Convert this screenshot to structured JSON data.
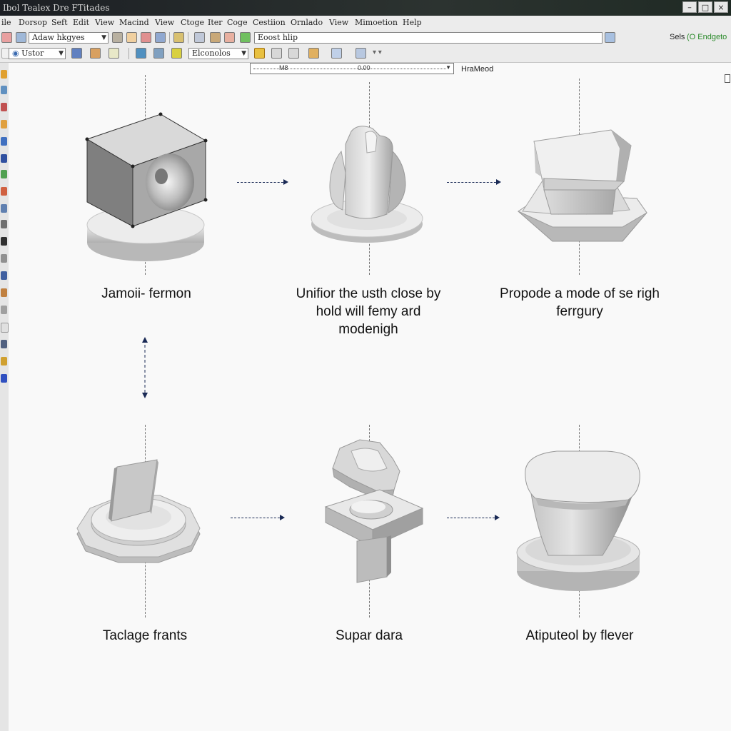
{
  "window": {
    "title": "Ibol Tealex Dre FTitades",
    "buttons": [
      "–",
      "□",
      "×"
    ]
  },
  "menubar": {
    "items": [
      "ile",
      "Dorsop",
      "Seft",
      "Edit",
      "View",
      "Macind",
      "View",
      "Ctoge",
      "Iter",
      "Coge",
      "Cestiion",
      "Ornlado",
      "View",
      "Mimoetion",
      "Help"
    ]
  },
  "toolbar1": {
    "layer_combo": "Adaw hkgyes",
    "help_field": "Eoost hlip",
    "right_label": "Sels",
    "right_status": "(O Endgeto"
  },
  "toolbar2": {
    "view_combo": "Ustor",
    "style_combo": "Elconolos"
  },
  "ruler": {
    "left_mark": "M8",
    "value": "0.00",
    "label": "HraMeod"
  },
  "steps": [
    {
      "caption": "Jamoii- fermon"
    },
    {
      "caption": "Unifior the usth close by hold will femy ard modenigh"
    },
    {
      "caption": "Propode a mode of se righ ferrgury"
    },
    {
      "caption": "Taclage frants"
    },
    {
      "caption": "Supar dara"
    },
    {
      "caption": "Atiputeol by flever"
    }
  ],
  "colors": {
    "titlebar": "#1c1f24",
    "toolbar": "#ebebeb",
    "viewport": "#f9f9f9",
    "arrow": "#1a2a55",
    "model_light": "#e6e6e6",
    "model_mid": "#bdbdbd",
    "model_dark": "#8f8f8f"
  },
  "icons": {
    "shape1": "cube-on-disc-icon",
    "shape2": "saddle-block-icon",
    "shape3": "chamfered-pedestal-icon",
    "shape4": "wedge-on-gear-base-icon",
    "shape5": "exploded-stand-icon",
    "shape6": "rounded-anvil-icon"
  }
}
